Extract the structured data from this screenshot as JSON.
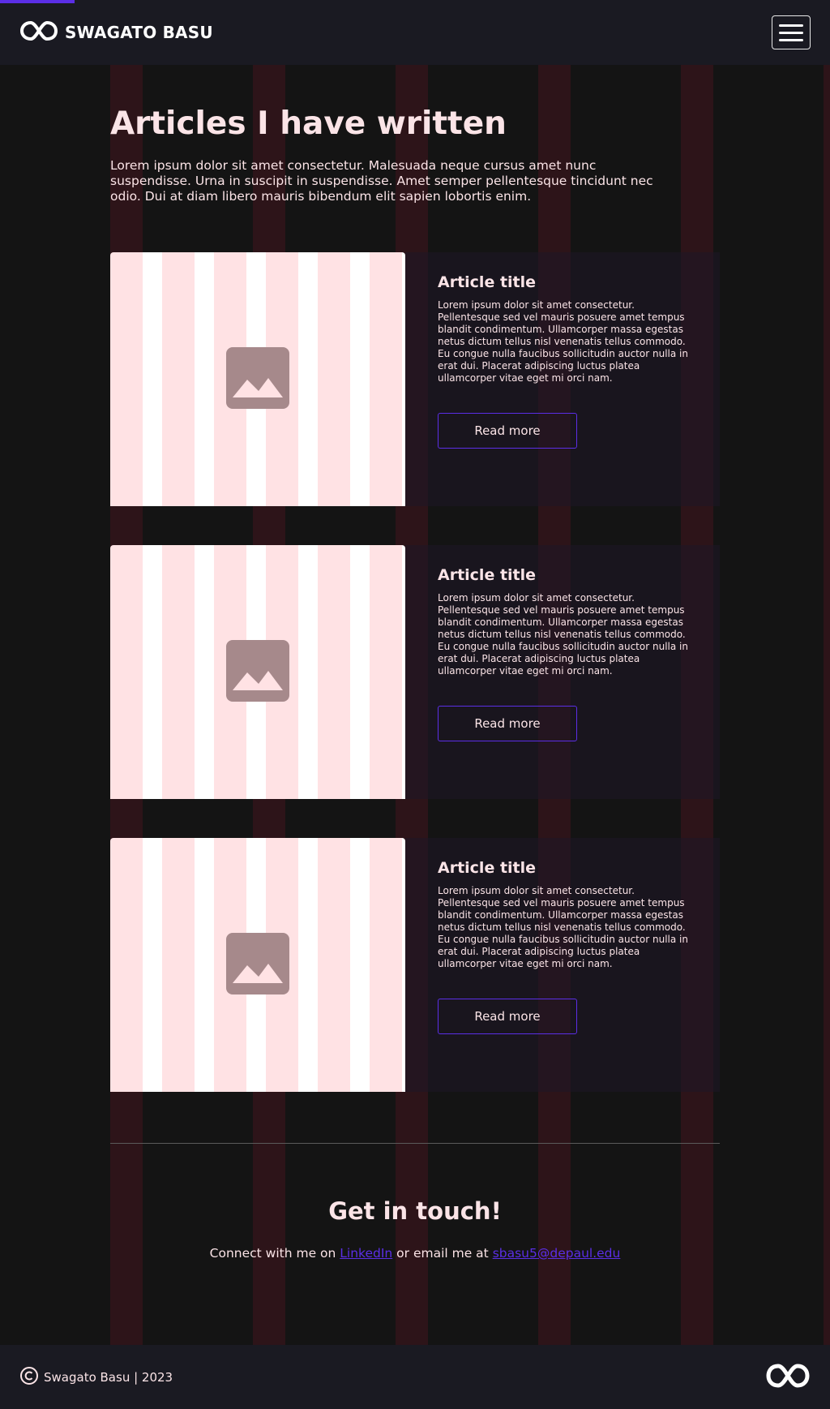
{
  "header": {
    "brand_name": "SWAGATO BASU",
    "menu_icon": "hamburger-menu-icon"
  },
  "page": {
    "title": "Articles I have written",
    "intro": "Lorem ipsum dolor sit amet consectetur. Malesuada neque cursus amet nunc suspendisse. Urna in suscipit in suspendisse. Amet semper pellentesque tincidunt nec odio. Dui at diam libero mauris bibendum elit sapien lobortis enim."
  },
  "articles": [
    {
      "title": "Article title",
      "text": "Lorem ipsum dolor sit amet consectetur. Pellentesque sed vel mauris posuere amet tempus blandit condimentum. Ullamcorper massa egestas netus dictum tellus nisl venenatis tellus commodo. Eu congue nulla faucibus sollicitudin auctor nulla in erat dui. Placerat adipiscing luctus platea ullamcorper vitae eget mi orci nam.",
      "button": "Read more",
      "image_icon": "image-placeholder-icon"
    },
    {
      "title": "Article title",
      "text": "Lorem ipsum dolor sit amet consectetur. Pellentesque sed vel mauris posuere amet tempus blandit condimentum. Ullamcorper massa egestas netus dictum tellus nisl venenatis tellus commodo. Eu congue nulla faucibus sollicitudin auctor nulla in erat dui. Placerat adipiscing luctus platea ullamcorper vitae eget mi orci nam.",
      "button": "Read more",
      "image_icon": "image-placeholder-icon"
    },
    {
      "title": "Article title",
      "text": "Lorem ipsum dolor sit amet consectetur. Pellentesque sed vel mauris posuere amet tempus blandit condimentum. Ullamcorper massa egestas netus dictum tellus nisl venenatis tellus commodo. Eu congue nulla faucibus sollicitudin auctor nulla in erat dui. Placerat adipiscing luctus platea ullamcorper vitae eget mi orci nam.",
      "button": "Read more",
      "image_icon": "image-placeholder-icon"
    }
  ],
  "contact": {
    "title": "Get in touch!",
    "prefix": "Connect with me on ",
    "linkedin_label": "LinkedIn",
    "middle": " or email me at ",
    "email": "sbasu5@depaul.edu"
  },
  "footer": {
    "copyright": "Swagato Basu | 2023"
  },
  "colors": {
    "accent": "#5b2ee6",
    "background": "#141414",
    "text": "#fbe4e7"
  }
}
